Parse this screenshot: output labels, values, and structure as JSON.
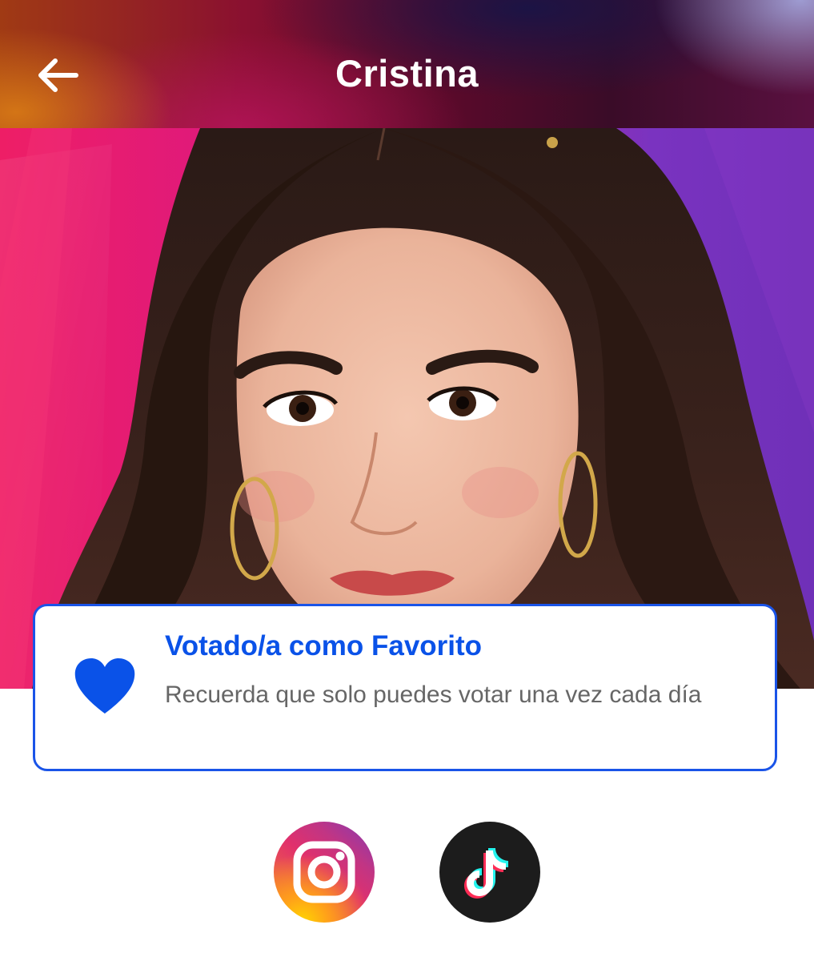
{
  "header": {
    "title": "Cristina",
    "back_icon": "arrow-left-icon",
    "colors": {
      "top_left": "#c0621a",
      "center": "#5a0a2a",
      "top_right": "#b9b6e6"
    }
  },
  "hero": {
    "image": "contestant-photo",
    "background_colors": [
      "#ee1e66",
      "#b52aa0",
      "#6f30b8"
    ]
  },
  "vote_card": {
    "icon": "heart-icon",
    "title": "Votado/a como Favorito",
    "description": "Recuerda que solo puedes votar una vez cada día",
    "accent_color": "#1a54e8"
  },
  "social": {
    "items": [
      {
        "icon": "instagram-icon",
        "label": "Instagram"
      },
      {
        "icon": "tiktok-icon",
        "label": "TikTok"
      }
    ]
  }
}
